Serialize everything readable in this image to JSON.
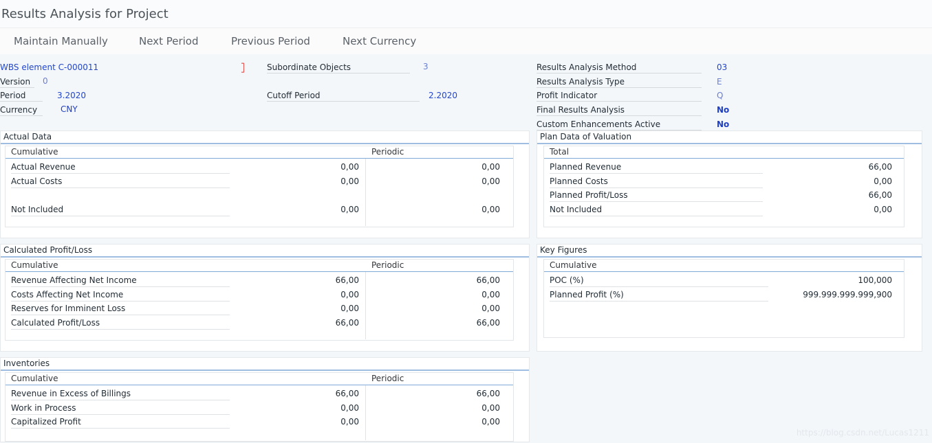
{
  "window": {
    "title": "Results Analysis for Project"
  },
  "toolbar": {
    "maintain": "Maintain Manually",
    "next_period": "Next Period",
    "prev_period": "Previous Period",
    "next_currency": "Next Currency"
  },
  "header": {
    "wbs": "WBS element C-000011",
    "version_label": "Version",
    "version_value": "0",
    "period_label": "Period",
    "period_value": "3.2020",
    "currency_label": "Currency",
    "currency_value": "CNY",
    "subordinate_label": "Subordinate Objects",
    "subordinate_value": "3",
    "cutoff_label": "Cutoff Period",
    "cutoff_value": "2.2020",
    "ram_label": "Results Analysis Method",
    "ram_value": "03",
    "rat_label": "Results Analysis Type",
    "rat_value": "E",
    "pi_label": "Profit Indicator",
    "pi_value": "Q",
    "fra_label": "Final Results Analysis",
    "fra_value": "No",
    "cea_label": "Custom Enhancements Active",
    "cea_value": "No"
  },
  "actual": {
    "title": "Actual Data",
    "col_cum": "Cumulative",
    "col_per": "Periodic",
    "rows": [
      {
        "label": "Actual Revenue",
        "cum": "0,00",
        "per": "0,00"
      },
      {
        "label": "Actual Costs",
        "cum": "0,00",
        "per": "0,00"
      },
      {
        "label": "Not Included",
        "cum": "0,00",
        "per": "0,00"
      }
    ]
  },
  "plan": {
    "title": "Plan Data of Valuation",
    "col_total": "Total",
    "rows": [
      {
        "label": "Planned Revenue",
        "val": "66,00"
      },
      {
        "label": "Planned Costs",
        "val": "0,00"
      },
      {
        "label": "Planned Profit/Loss",
        "val": "66,00"
      },
      {
        "label": "Not Included",
        "val": "0,00"
      }
    ]
  },
  "calc": {
    "title": "Calculated Profit/Loss",
    "col_cum": "Cumulative",
    "col_per": "Periodic",
    "rows": [
      {
        "label": "Revenue Affecting Net Income",
        "cum": "66,00",
        "per": "66,00"
      },
      {
        "label": "Costs Affecting Net Income",
        "cum": "0,00",
        "per": "0,00"
      },
      {
        "label": "Reserves for Imminent Loss",
        "cum": "0,00",
        "per": "0,00"
      },
      {
        "label": "Calculated Profit/Loss",
        "cum": "66,00",
        "per": "66,00"
      }
    ]
  },
  "keyfig": {
    "title": "Key Figures",
    "col_cum": "Cumulative",
    "rows": [
      {
        "label": "POC (%)",
        "val": "100,000"
      },
      {
        "label": "Planned Profit (%)",
        "val": "999.999.999.999,900"
      }
    ]
  },
  "inv": {
    "title": "Inventories",
    "col_cum": "Cumulative",
    "col_per": "Periodic",
    "rows": [
      {
        "label": "Revenue in Excess of Billings",
        "cum": "66,00",
        "per": "66,00"
      },
      {
        "label": "Work in Process",
        "cum": "0,00",
        "per": "0,00"
      },
      {
        "label": "Capitalized Profit",
        "cum": "0,00",
        "per": "0,00"
      }
    ]
  },
  "watermark": "https://blog.csdn.net/Lucas1211"
}
